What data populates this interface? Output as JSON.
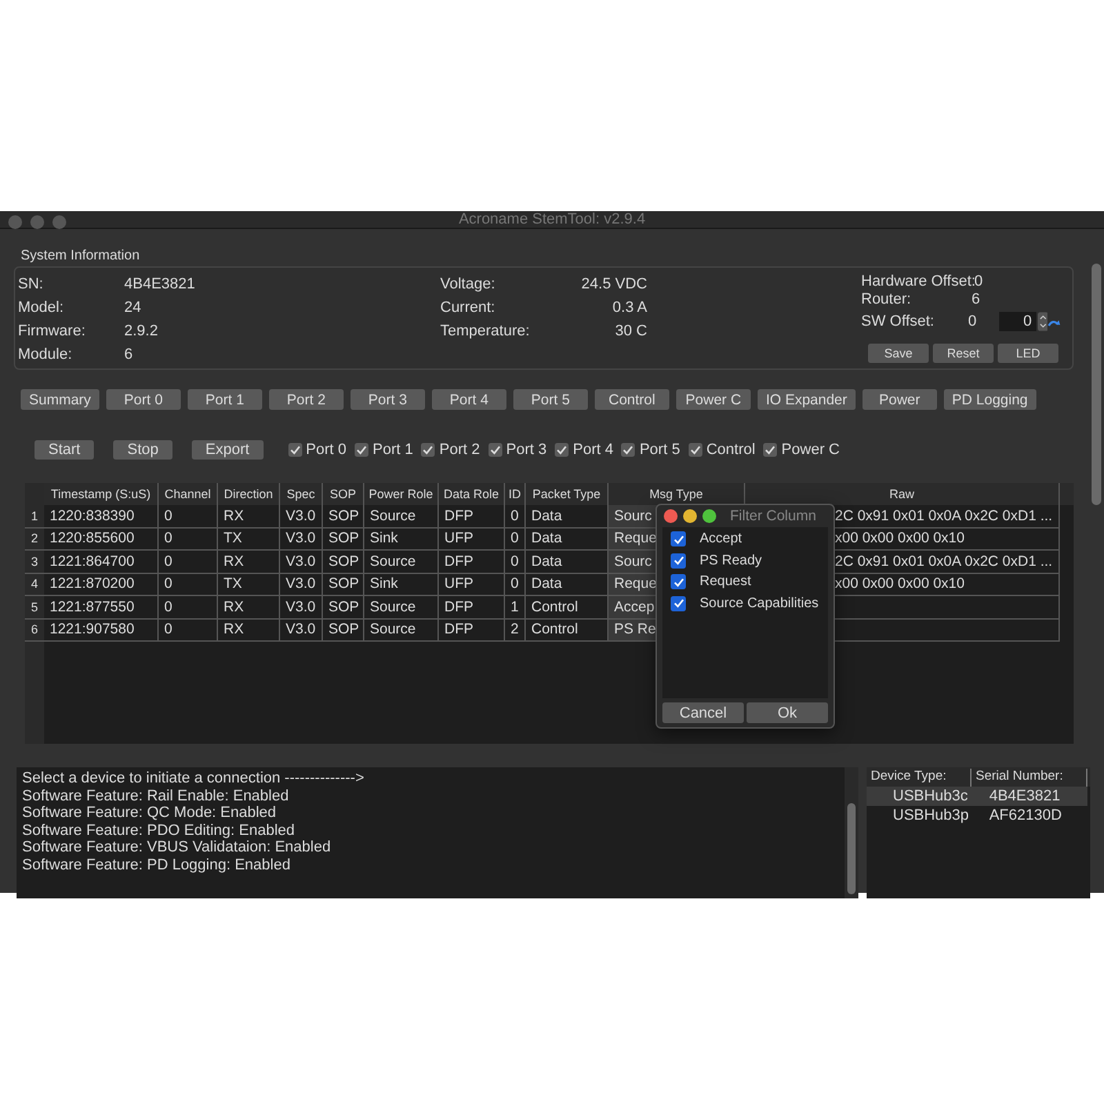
{
  "window": {
    "title": "Acroname StemTool: v2.9.4"
  },
  "system_info": {
    "title": "System Information",
    "left": [
      {
        "label": "SN:",
        "value": "4B4E3821"
      },
      {
        "label": "Model:",
        "value": "24"
      },
      {
        "label": "Firmware:",
        "value": "2.9.2"
      },
      {
        "label": "Module:",
        "value": "6"
      }
    ],
    "middle": [
      {
        "label": "Voltage:",
        "value": "24.5 VDC"
      },
      {
        "label": "Current:",
        "value": "0.3 A"
      },
      {
        "label": "Temperature:",
        "value": "30 C"
      }
    ],
    "hardware_offset": {
      "label": "Hardware Offset:",
      "value": "0"
    },
    "router": {
      "label": "Router:",
      "value": "6"
    },
    "sw_offset": {
      "label": "SW Offset:",
      "value": "0",
      "input": "0"
    },
    "buttons": [
      "Save",
      "Reset",
      "LED"
    ]
  },
  "tabs": [
    {
      "label": "Summary",
      "selected": false
    },
    {
      "label": "Port 0",
      "selected": false
    },
    {
      "label": "Port 1",
      "selected": false
    },
    {
      "label": "Port 2",
      "selected": false
    },
    {
      "label": "Port 3",
      "selected": false
    },
    {
      "label": "Port 4",
      "selected": false
    },
    {
      "label": "Port 5",
      "selected": false
    },
    {
      "label": "Control",
      "selected": false
    },
    {
      "label": "Power C",
      "selected": false
    },
    {
      "label": "IO Expander",
      "selected": false
    },
    {
      "label": "Power",
      "selected": false
    },
    {
      "label": "PD Logging",
      "selected": false
    }
  ],
  "log_buttons": [
    "Start",
    "Stop",
    "Export"
  ],
  "filters": [
    {
      "label": "Port 0",
      "checked": true
    },
    {
      "label": "Port 1",
      "checked": true
    },
    {
      "label": "Port 2",
      "checked": true
    },
    {
      "label": "Port 3",
      "checked": true
    },
    {
      "label": "Port 4",
      "checked": true
    },
    {
      "label": "Port 5",
      "checked": true
    },
    {
      "label": "Control",
      "checked": true
    },
    {
      "label": "Power C",
      "checked": true
    }
  ],
  "table": {
    "columns": [
      "Timestamp (S:uS)",
      "Channel",
      "Direction",
      "Spec",
      "SOP",
      "Power Role",
      "Data Role",
      "ID",
      "Packet Type",
      "Msg Type",
      "Raw"
    ],
    "rows": [
      {
        "number": "1",
        "cells": [
          "1220:838390",
          "0",
          "RX",
          "V3.0",
          "SOP",
          "Source",
          "DFP",
          "0",
          "Data",
          "Sourc",
          "2C 0x91 0x01 0x0A 0x2C 0xD1 ..."
        ]
      },
      {
        "number": "2",
        "cells": [
          "1220:855600",
          "0",
          "TX",
          "V3.0",
          "SOP",
          "Sink",
          "UFP",
          "0",
          "Data",
          "Reque",
          "x00 0x00 0x00 0x10"
        ]
      },
      {
        "number": "3",
        "cells": [
          "1221:864700",
          "0",
          "RX",
          "V3.0",
          "SOP",
          "Source",
          "DFP",
          "0",
          "Data",
          "Sourc",
          "2C 0x91 0x01 0x0A 0x2C 0xD1 ..."
        ]
      },
      {
        "number": "4",
        "cells": [
          "1221:870200",
          "0",
          "TX",
          "V3.0",
          "SOP",
          "Sink",
          "UFP",
          "0",
          "Data",
          "Reque",
          "x00 0x00 0x00 0x10"
        ]
      },
      {
        "number": "5",
        "cells": [
          "1221:877550",
          "0",
          "RX",
          "V3.0",
          "SOP",
          "Source",
          "DFP",
          "1",
          "Control",
          "Accep"
        ]
      },
      {
        "number": "6",
        "cells": [
          "1221:907580",
          "0",
          "RX",
          "V3.0",
          "SOP",
          "Source",
          "DFP",
          "2",
          "Control",
          "PS Re"
        ]
      }
    ]
  },
  "filter_dialog": {
    "title": "Filter Column",
    "items": [
      {
        "label": "Accept",
        "checked": true
      },
      {
        "label": "PS Ready",
        "checked": true
      },
      {
        "label": "Request",
        "checked": true
      },
      {
        "label": "Source Capabilities",
        "checked": true
      }
    ],
    "buttons": [
      "Cancel",
      "Ok"
    ]
  },
  "log": [
    "Select a device to initiate a connection -------------->",
    "Software Feature: Rail Enable: Enabled",
    "Software Feature: QC Mode: Enabled",
    "Software Feature: PDO Editing: Enabled",
    "Software Feature: VBUS Validataion: Enabled",
    "Software Feature: PD Logging: Enabled"
  ],
  "devices": {
    "columns": [
      "Device Type:",
      "Serial Number:"
    ],
    "rows": [
      {
        "type": "USBHub3c",
        "serial": "4B4E3821",
        "selected": true
      },
      {
        "type": "USBHub3p",
        "serial": "AF62130D",
        "selected": false
      }
    ]
  }
}
